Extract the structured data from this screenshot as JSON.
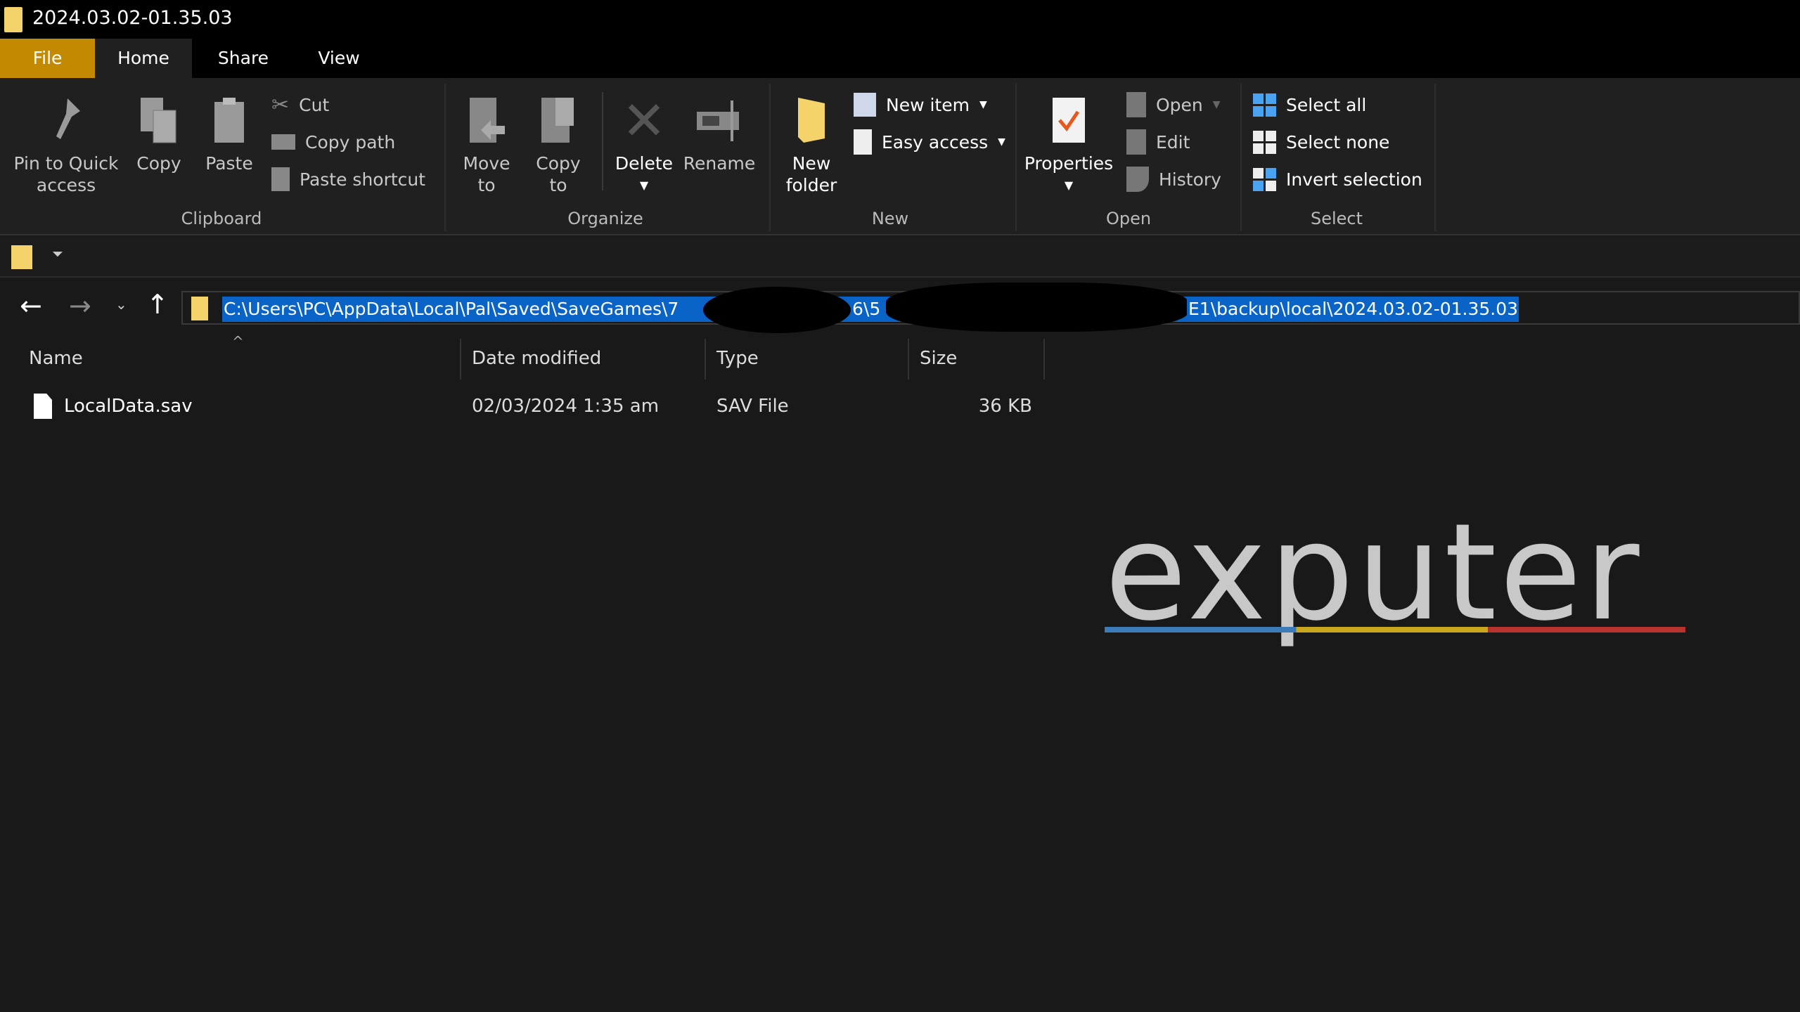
{
  "window": {
    "title": "2024.03.02-01.35.03"
  },
  "tabs": [
    {
      "label": "File"
    },
    {
      "label": "Home"
    },
    {
      "label": "Share"
    },
    {
      "label": "View"
    }
  ],
  "ribbon": {
    "clipboard": {
      "label": "Clipboard",
      "pin": "Pin to Quick",
      "pin2": "access",
      "copy": "Copy",
      "paste": "Paste",
      "cut": "Cut",
      "copy_path": "Copy path",
      "paste_shortcut": "Paste shortcut"
    },
    "organize": {
      "label": "Organize",
      "move": "Move",
      "move2": "to",
      "copyto": "Copy",
      "copyto2": "to",
      "delete": "Delete",
      "rename": "Rename"
    },
    "new": {
      "label": "New",
      "new_folder": "New",
      "new_folder2": "folder",
      "new_item": "New item",
      "easy_access": "Easy access"
    },
    "open": {
      "label": "Open",
      "properties": "Properties",
      "open": "Open",
      "edit": "Edit",
      "history": "History"
    },
    "select": {
      "label": "Select",
      "select_all": "Select all",
      "select_none": "Select none",
      "invert": "Invert selection"
    }
  },
  "address": {
    "seg1": "C:\\Users\\PC\\AppData\\Local\\Pal\\Saved\\SaveGames\\7",
    "seg2": "6\\5",
    "seg3": "E1\\backup\\local\\2024.03.02-01.35.03"
  },
  "columns": [
    {
      "label": "Name"
    },
    {
      "label": "Date modified"
    },
    {
      "label": "Type"
    },
    {
      "label": "Size"
    }
  ],
  "files": [
    {
      "name": "LocalData.sav",
      "date": "02/03/2024 1:35 am",
      "type": "SAV File",
      "size": "36 KB"
    }
  ],
  "watermark": {
    "text": "exputer"
  },
  "colors": {
    "file_tab": "#c38a00",
    "selection": "#0a64c8",
    "folder": "#f5d36b"
  }
}
